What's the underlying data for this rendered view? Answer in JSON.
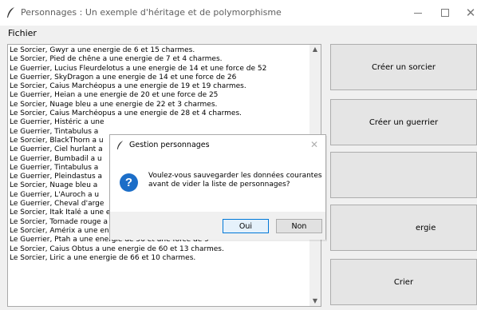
{
  "window": {
    "title": "Personnages : Un exemple d'héritage et de polymorphisme",
    "minimize": "minimize",
    "maximize": "maximize",
    "close": "✕"
  },
  "menu": {
    "items": [
      "Fichier"
    ]
  },
  "list": {
    "items": [
      "Le Sorcier, Gwyr a une energie de 6 et 15 charmes.",
      "Le Sorcier, Pied de chêne a une energie de 7 et 4 charmes.",
      "Le Guerrier, Lucius Fleurdelotus a une energie de 14 et une force de 52",
      "Le Guerrier, SkyDragon a une energie de 14 et une force de 26",
      "Le Sorcier, Caius Marchéopus a une energie de 19 et 19 charmes.",
      "Le Guerrier, Heian a une energie de 20 et une force de 25",
      "Le Sorcier, Nuage bleu a une energie de 22 et 3 charmes.",
      "Le Sorcier, Caius Marchéopus a une energie de 28 et 4 charmes.",
      "Le Guerrier, Histéric a une",
      "Le Guerrier, Tintabulus a",
      "Le Sorcier, BlackThorn a u",
      "Le Guerrier, Ciel hurlant a",
      "Le Guerrier, Bumbadil a u",
      "Le Guerrier, Tintabulus a",
      "Le Guerrier, Pleindastus a",
      "Le Sorcier, Nuage bleu a",
      "Le Guerrier, L'Auroch a u",
      "Le Guerrier, Cheval d'arge",
      "Le Sorcier, Itak Italé a une energie de 55 et 10 charmes.",
      "Le Sorcier, Tornade rouge a une energie de 55 et 13 charmes.",
      "Le Sorcier, Amérix a une energie de 56 et 16 charmes.",
      "Le Guerrier, Ptah a une energie de 56 et une force de 9",
      "Le Sorcier, Caius Obtus a une energie de 60 et 13 charmes.",
      "Le Sorcier, Liric a une energie de 66 et 10 charmes."
    ]
  },
  "buttons": {
    "create_sorcerer": "Créer un sorcier",
    "create_warrior": "Créer un guerrier",
    "energy": "ergie",
    "shout": "Crier"
  },
  "dialog": {
    "title": "Gestion personnages",
    "close": "✕",
    "message": "Voulez-vous sauvegarder les données courantes avant de vider la liste de personnages?",
    "icon": "?",
    "yes": "Oui",
    "no": "Non"
  },
  "colors": {
    "accent": "#0078d7",
    "question_icon": "#1c6ec8"
  }
}
